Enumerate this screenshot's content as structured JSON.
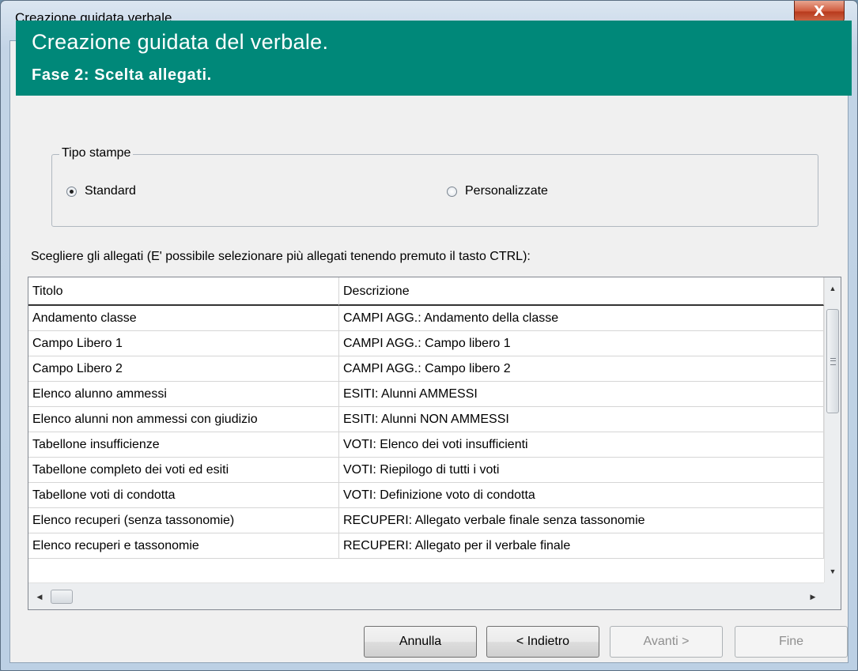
{
  "window": {
    "title": "Creazione guidata verbale",
    "close_glyph": "X"
  },
  "banner": {
    "title": "Creazione guidata del verbale.",
    "subtitle": "Fase 2: Scelta allegati.",
    "color": "#008879"
  },
  "print_type": {
    "legend": "Tipo stampe",
    "options": [
      {
        "label": "Standard",
        "checked": true
      },
      {
        "label": "Personalizzate",
        "checked": false
      }
    ]
  },
  "instruction": "Scegliere gli allegati (E' possibile selezionare più allegati tenendo premuto il tasto CTRL):",
  "list": {
    "columns": [
      "Titolo",
      "Descrizione"
    ],
    "rows": [
      {
        "title": "Andamento classe",
        "description": "CAMPI AGG.: Andamento della classe"
      },
      {
        "title": "Campo Libero 1",
        "description": "CAMPI AGG.: Campo libero 1"
      },
      {
        "title": "Campo Libero 2",
        "description": "CAMPI AGG.: Campo libero 2"
      },
      {
        "title": "Elenco alunno ammessi",
        "description": "ESITI: Alunni AMMESSI"
      },
      {
        "title": "Elenco alunni non ammessi con giudizio",
        "description": "ESITI: Alunni NON AMMESSI"
      },
      {
        "title": "Tabellone insufficienze",
        "description": "VOTI: Elenco dei voti insufficienti"
      },
      {
        "title": "Tabellone completo dei voti ed esiti",
        "description": "VOTI: Riepilogo di tutti i voti"
      },
      {
        "title": "Tabellone voti di condotta",
        "description": "VOTI: Definizione voto di condotta"
      },
      {
        "title": "Elenco recuperi (senza tassonomie)",
        "description": "RECUPERI: Allegato verbale finale senza tassonomie"
      },
      {
        "title": "Elenco recuperi e tassonomie",
        "description": "RECUPERI: Allegato per il verbale finale"
      }
    ]
  },
  "buttons": {
    "cancel": "Annulla",
    "back": "< Indietro",
    "next": "Avanti >",
    "finish": "Fine"
  },
  "icons": {
    "scroll_up": "▲",
    "scroll_down": "▼",
    "scroll_left": "◀",
    "scroll_right": "▶"
  }
}
